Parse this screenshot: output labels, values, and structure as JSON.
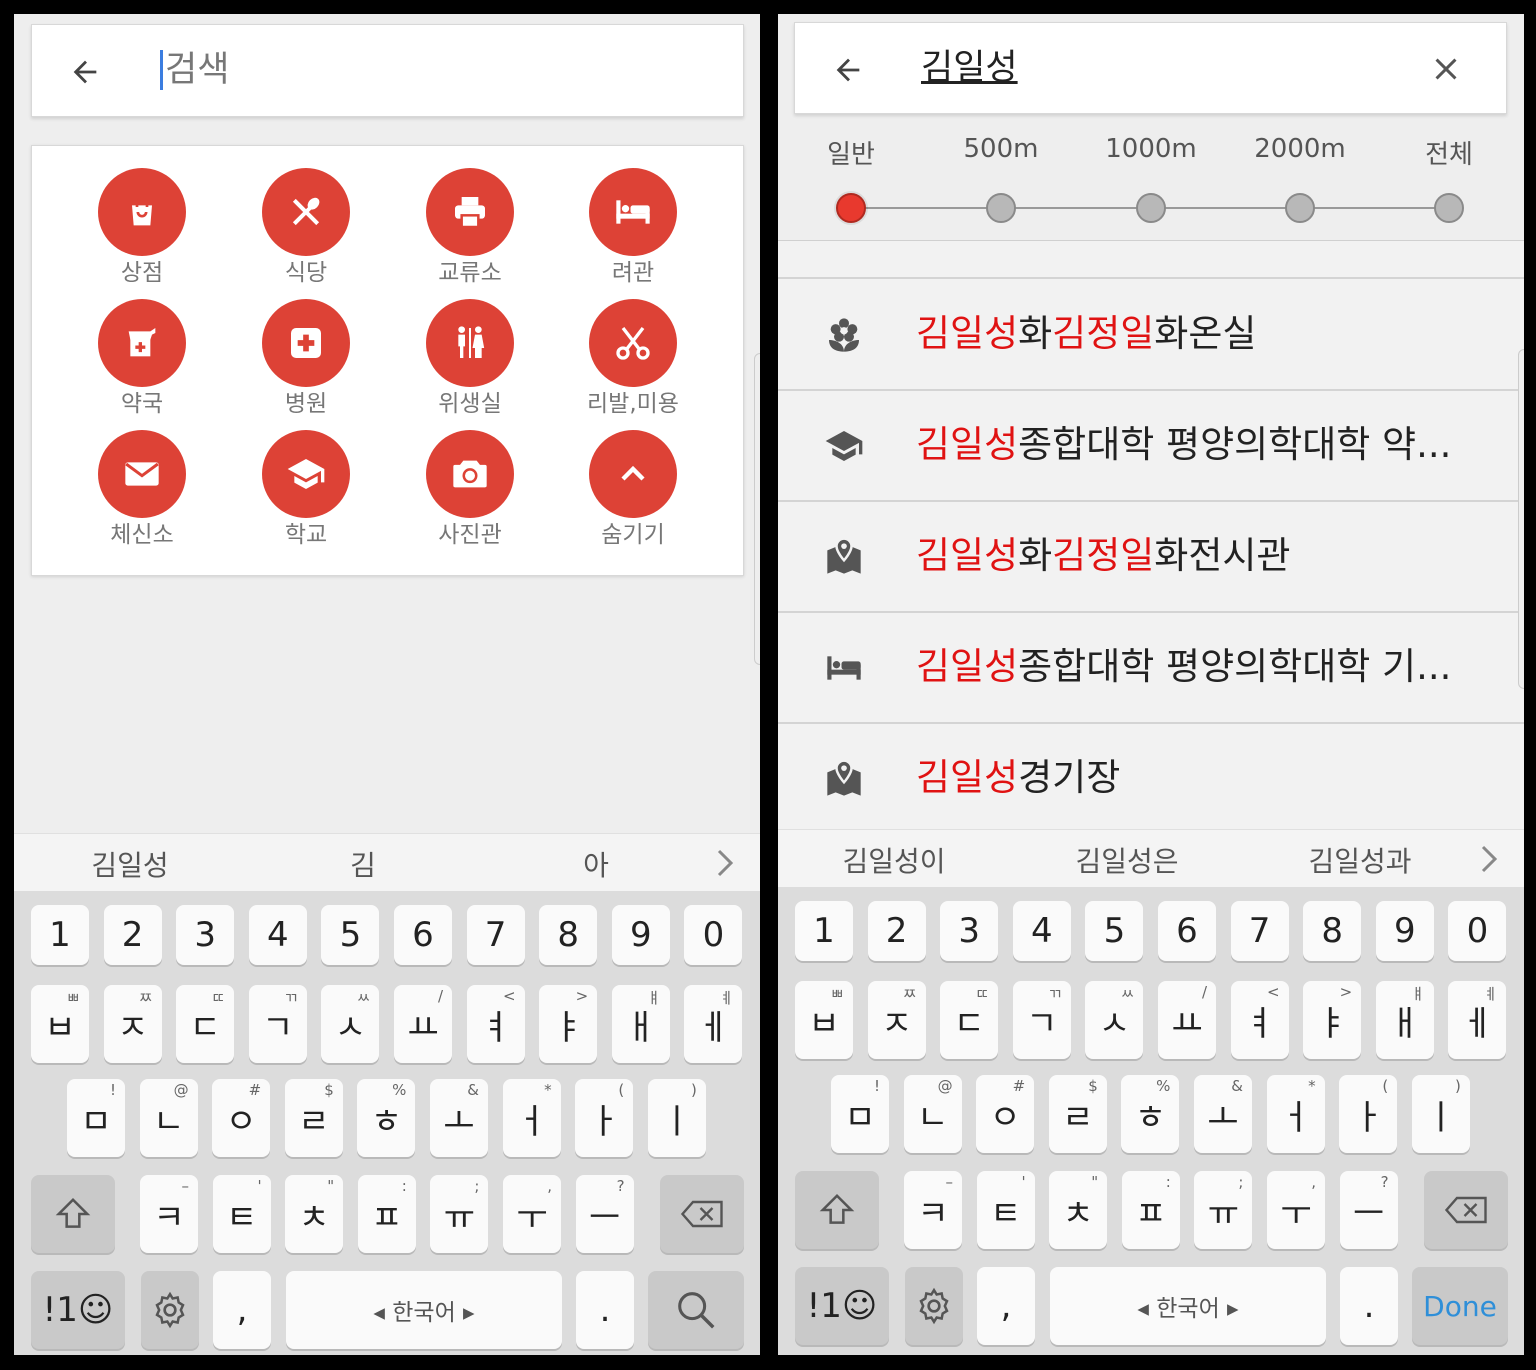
{
  "left": {
    "search": {
      "placeholder": "검색"
    },
    "categories": [
      {
        "label": "상점",
        "icon": "shopping-bag-icon"
      },
      {
        "label": "식당",
        "icon": "restaurant-icon"
      },
      {
        "label": "교류소",
        "icon": "printer-icon"
      },
      {
        "label": "려관",
        "icon": "hotel-bed-icon"
      },
      {
        "label": "약국",
        "icon": "pharmacy-icon"
      },
      {
        "label": "병원",
        "icon": "hospital-icon"
      },
      {
        "label": "위생실",
        "icon": "restroom-icon"
      },
      {
        "label": "리발,미용",
        "icon": "scissors-icon"
      },
      {
        "label": "체신소",
        "icon": "mail-icon"
      },
      {
        "label": "학교",
        "icon": "school-icon"
      },
      {
        "label": "사진관",
        "icon": "camera-icon"
      },
      {
        "label": "숨기기",
        "icon": "chevron-up-icon"
      }
    ],
    "suggestions": [
      "김일성",
      "김",
      "아"
    ],
    "last_key": "search-icon"
  },
  "right": {
    "search": {
      "query": "김일성"
    },
    "distance": {
      "labels": [
        "일반",
        "500m",
        "1000m",
        "2000m",
        "전체"
      ],
      "selected_index": 0
    },
    "results": [
      {
        "icon": "flower-icon",
        "parts": [
          {
            "t": "김일성",
            "hl": true
          },
          {
            "t": "화",
            "hl": false
          },
          {
            "t": "김정일",
            "hl": true
          },
          {
            "t": "화온실",
            "hl": false
          }
        ]
      },
      {
        "icon": "school-icon",
        "parts": [
          {
            "t": "김일성",
            "hl": true
          },
          {
            "t": "종합대학 평양의학대학 약...",
            "hl": false
          }
        ]
      },
      {
        "icon": "map-pin-icon",
        "parts": [
          {
            "t": "김일성",
            "hl": true
          },
          {
            "t": "화",
            "hl": false
          },
          {
            "t": "김정일",
            "hl": true
          },
          {
            "t": "화전시관",
            "hl": false
          }
        ]
      },
      {
        "icon": "hotel-bed-icon",
        "parts": [
          {
            "t": "김일성",
            "hl": true
          },
          {
            "t": "종합대학 평양의학대학 기...",
            "hl": false
          }
        ]
      },
      {
        "icon": "map-pin-icon",
        "parts": [
          {
            "t": "김일성",
            "hl": true
          },
          {
            "t": "경기장",
            "hl": false
          }
        ]
      }
    ],
    "suggestions": [
      "김일성이",
      "김일성은",
      "김일성과"
    ],
    "last_key": "Done"
  },
  "keyboard": {
    "numbers": [
      "1",
      "2",
      "3",
      "4",
      "5",
      "6",
      "7",
      "8",
      "9",
      "0"
    ],
    "row1": [
      [
        "ㅂ",
        "ㅃ"
      ],
      [
        "ㅈ",
        "ㅉ"
      ],
      [
        "ㄷ",
        "ㄸ"
      ],
      [
        "ㄱ",
        "ㄲ"
      ],
      [
        "ㅅ",
        "ㅆ"
      ],
      [
        "ㅛ",
        "/"
      ],
      [
        "ㅕ",
        "<"
      ],
      [
        "ㅑ",
        ">"
      ],
      [
        "ㅐ",
        "ㅒ"
      ],
      [
        "ㅔ",
        "ㅖ"
      ]
    ],
    "row2": [
      [
        "ㅁ",
        "!"
      ],
      [
        "ㄴ",
        "@"
      ],
      [
        "ㅇ",
        "#"
      ],
      [
        "ㄹ",
        "$"
      ],
      [
        "ㅎ",
        "%"
      ],
      [
        "ㅗ",
        "&"
      ],
      [
        "ㅓ",
        "*"
      ],
      [
        "ㅏ",
        "("
      ],
      [
        "ㅣ",
        ")"
      ]
    ],
    "row3": [
      [
        "ㅋ",
        "–"
      ],
      [
        "ㅌ",
        "'"
      ],
      [
        "ㅊ",
        "\""
      ],
      [
        "ㅍ",
        ":"
      ],
      [
        "ㅠ",
        ";"
      ],
      [
        "ㅜ",
        ","
      ],
      [
        "ㅡ",
        "?"
      ]
    ],
    "symbols_label": "!1☺",
    "comma": ",",
    "space_label": "◂  한국어  ▸",
    "period": "."
  },
  "colors": {
    "accent": "#dd4236",
    "highlight": "#e01212",
    "done": "#2f8fd8"
  }
}
